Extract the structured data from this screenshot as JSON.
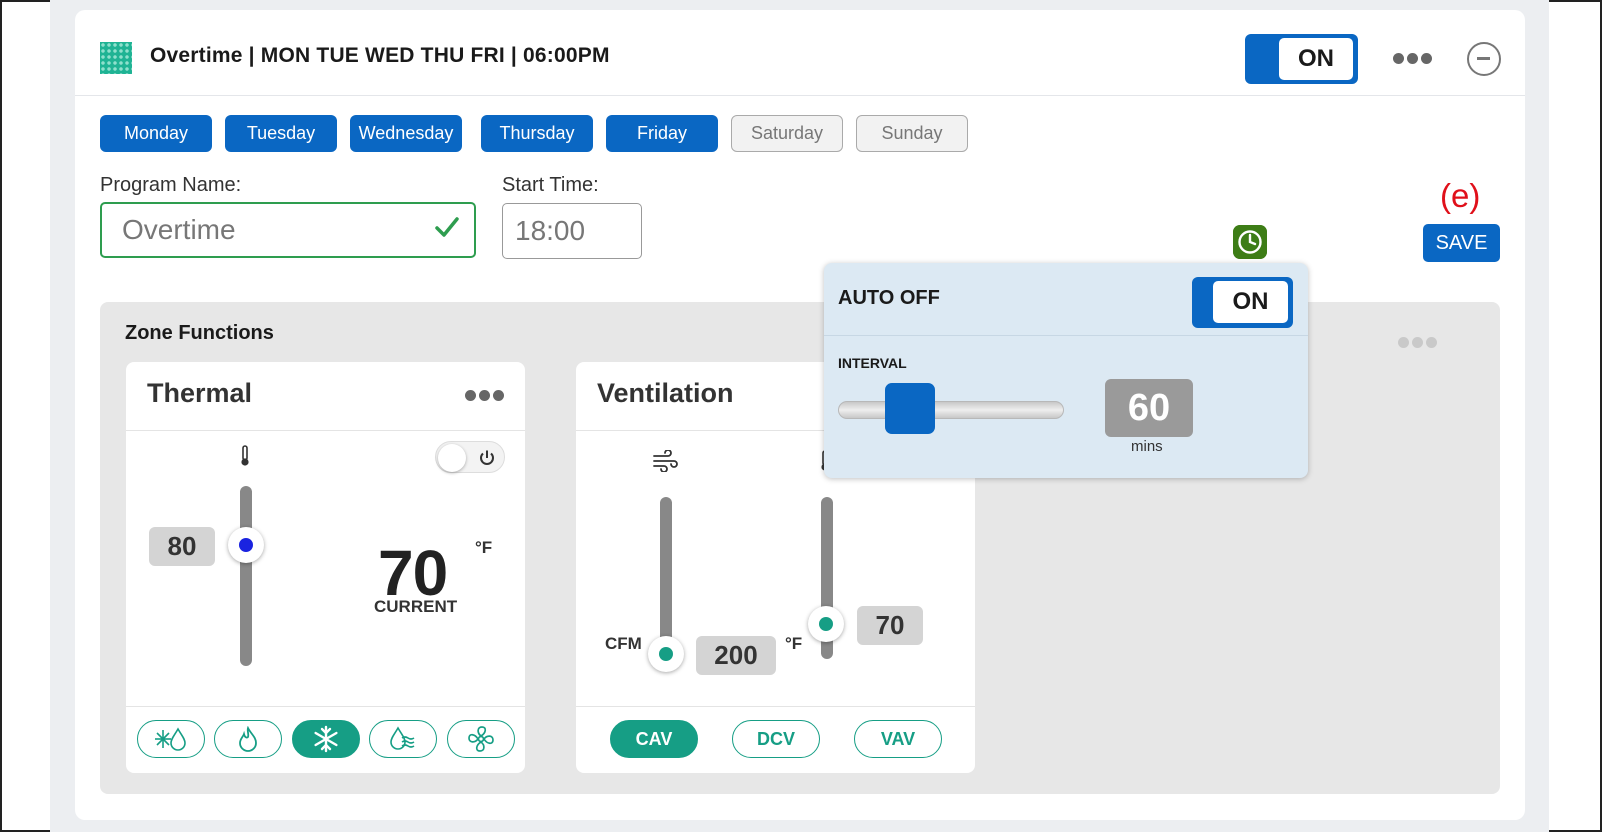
{
  "header": {
    "title": "Overtime | MON TUE WED THU FRI | 06:00PM",
    "toggle_label": "ON",
    "accent_color": "#0a67c3"
  },
  "days": [
    {
      "label": "Monday",
      "selected": true
    },
    {
      "label": "Tuesday",
      "selected": true
    },
    {
      "label": "Wednesday",
      "selected": true
    },
    {
      "label": "Thursday",
      "selected": true
    },
    {
      "label": "Friday",
      "selected": true
    },
    {
      "label": "Saturday",
      "selected": false
    },
    {
      "label": "Sunday",
      "selected": false
    }
  ],
  "program": {
    "name_label": "Program Name:",
    "name_value": "Overtime",
    "start_label": "Start Time:",
    "start_value": "18:00"
  },
  "annotation": "(e)",
  "save_label": "SAVE",
  "zone": {
    "title": "Zone Functions",
    "thermal": {
      "title": "Thermal",
      "setpoint": "80",
      "current_value": "70",
      "current_unit": "°F",
      "current_label": "CURRENT",
      "modes": [
        "auto-icon",
        "heat-icon",
        "cool-icon",
        "humidity-icon",
        "fan-icon"
      ],
      "active_mode": "cool-icon"
    },
    "ventilation": {
      "title": "Ventilation",
      "cfm_label": "CFM",
      "cfm_value": "200",
      "temp_unit": "°F",
      "temp_value": "70",
      "modes": [
        "CAV",
        "DCV",
        "VAV"
      ],
      "active_mode": "CAV"
    }
  },
  "auto_off": {
    "title": "AUTO OFF",
    "toggle_label": "ON",
    "interval_label": "INTERVAL",
    "interval_value": "60",
    "interval_unit": "mins"
  },
  "colors": {
    "primary": "#0a67c3",
    "teal": "#169e85",
    "valid": "#2e9d4f",
    "annotation": "#e0101a"
  }
}
